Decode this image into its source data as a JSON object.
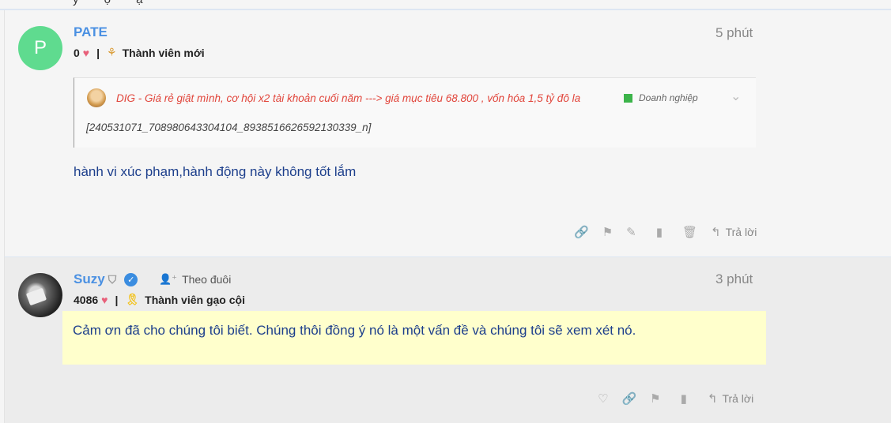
{
  "posts": [
    {
      "avatar_letter": "P",
      "username": "PATE",
      "likes": "0",
      "rank": "Thành viên mới",
      "time": "5 phút",
      "quote": {
        "title": "DIG - Giá rẻ giật mình, cơ hội x2 tài khoản cuối năm ---> giá mục tiêu 68.800 , vốn hóa 1,5 tỷ đô la",
        "category": "Doanh nghiệp",
        "body": "[240531071_708980643304104_8938516626592130339_n]"
      },
      "content": "hành vi xúc phạm,hành động này không tốt lắm",
      "reply_label": "Trả lời"
    },
    {
      "username": "Suzy",
      "follow_label": "Theo đuôi",
      "likes": "4086",
      "rank": "Thành viên gạo cội",
      "time": "3 phút",
      "content": "Cảm ơn đã cho chúng tôi biết. Chúng thôi đồng ý nó là một vấn đề và chúng tôi sẽ xem xét nó.",
      "reply_label": "Trả lời"
    }
  ],
  "icons": {
    "heart": "heart-icon",
    "link": "link-icon",
    "flag": "flag-icon",
    "edit": "pencil-icon",
    "bookmark": "bookmark-icon",
    "delete": "trash-icon",
    "reply": "reply-icon",
    "verified": "verified-icon"
  },
  "colors": {
    "username": "#4a90e2",
    "content": "#1d3f8c",
    "quote_title": "#e1453b",
    "heart": "#e8607a",
    "avatar_p": "#5fdb8f",
    "highlight": "#ffffcc"
  }
}
